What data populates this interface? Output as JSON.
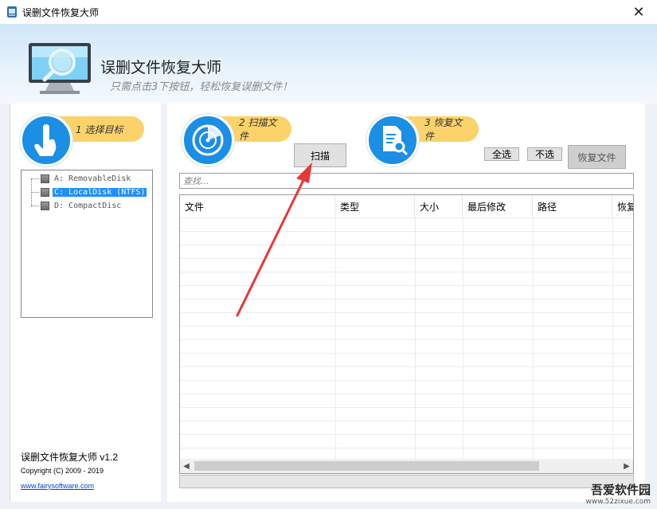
{
  "window": {
    "title": "误删文件恢复大师",
    "close_glyph": "✕"
  },
  "banner": {
    "app_name": "误删文件恢复大师",
    "slogan": "只需点击3下按钮，轻松恢复误删文件！"
  },
  "steps": [
    {
      "label": "1 选择目标",
      "icon": "hand-pointer-icon"
    },
    {
      "label": "2 扫描文件",
      "icon": "radar-scan-icon"
    },
    {
      "label": "3 恢复文件",
      "icon": "document-search-icon"
    }
  ],
  "drives": [
    {
      "label": "A: RemovableDisk",
      "selected": false
    },
    {
      "label": "C: LocalDisk (NTFS)",
      "selected": true
    },
    {
      "label": "D: CompactDisc",
      "selected": false
    }
  ],
  "footer": {
    "version": "误删文件恢复大师 v1.2",
    "copyright": "Copyright (C) 2009 - 2019",
    "website": "www.fairysoftware.com"
  },
  "toolbar": {
    "scan_label": "扫描",
    "select_all_label": "全选",
    "select_none_label": "不选",
    "recover_label": "恢复文件"
  },
  "search": {
    "placeholder": "查找..."
  },
  "table": {
    "columns": [
      "文件",
      "类型",
      "大小",
      "最后修改",
      "路径",
      "恢复"
    ]
  },
  "watermark": {
    "main": "吾爱软件园",
    "url": "www.52zixue.com"
  },
  "colors": {
    "accent": "#1b8ee6",
    "step_badge": "#fcd26a",
    "annotation_arrow": "#e53935",
    "selection": "#1e90ff"
  }
}
